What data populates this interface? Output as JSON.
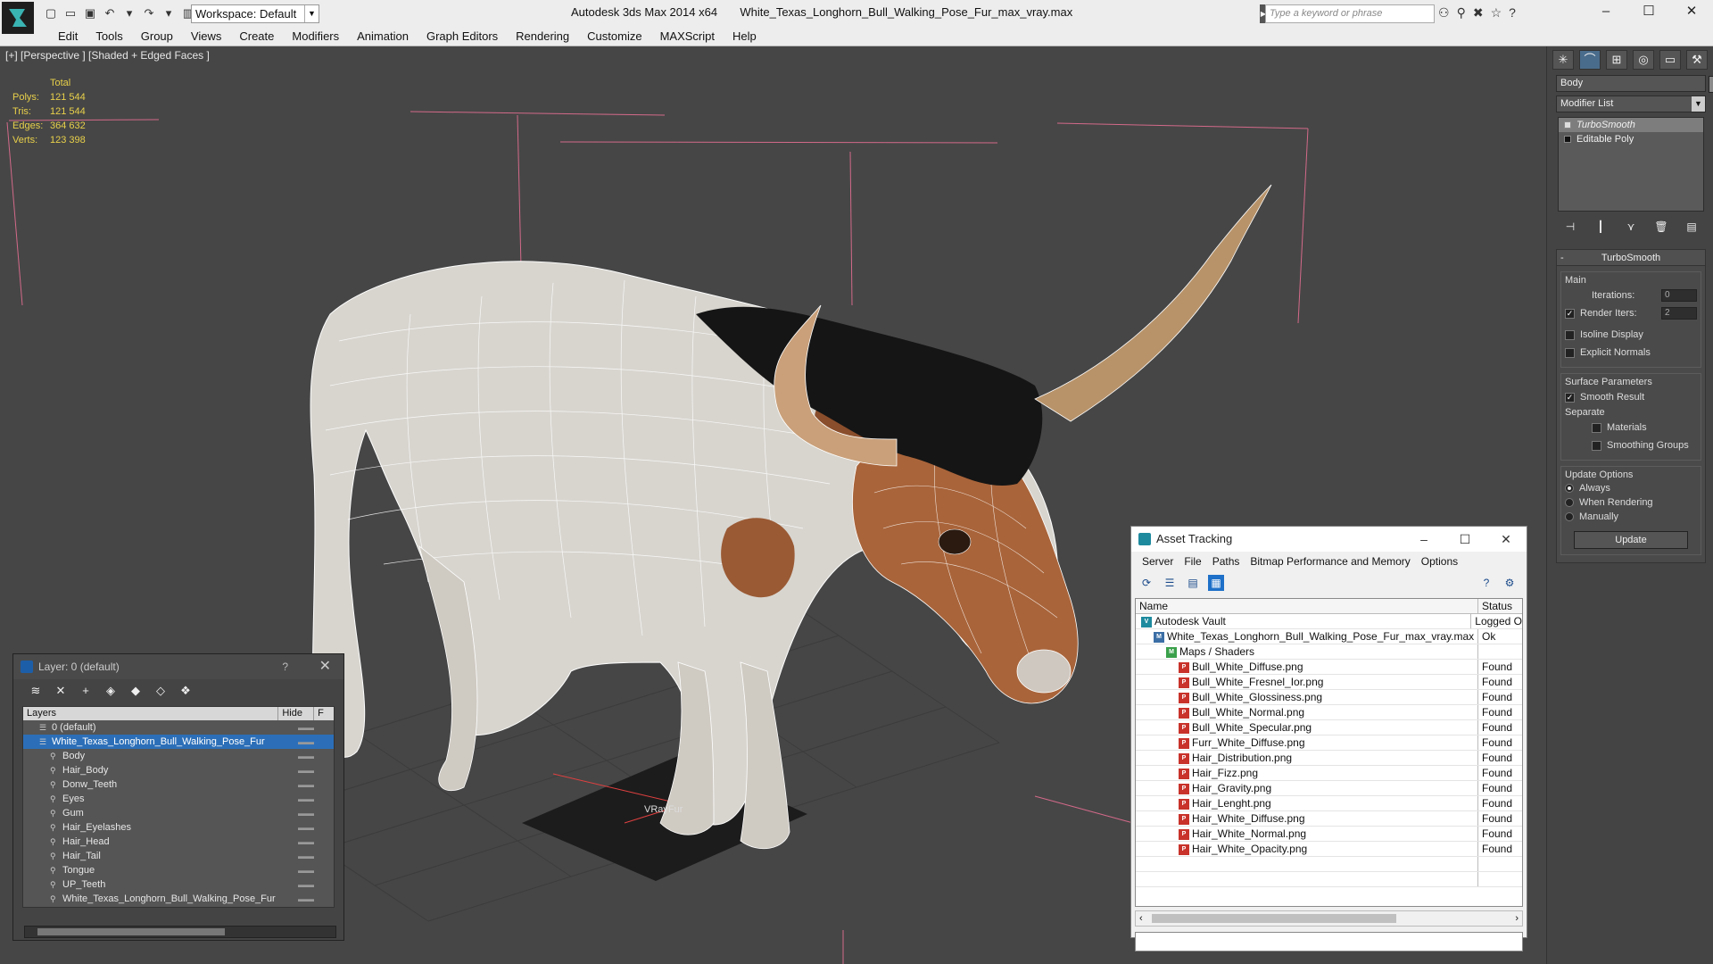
{
  "titlebar": {
    "workspace": "Workspace: Default",
    "app": "Autodesk 3ds Max  2014 x64",
    "file": "White_Texas_Longhorn_Bull_Walking_Pose_Fur_max_vray.max",
    "search_placeholder": "Type a keyword or phrase",
    "controls": [
      "–",
      "☐",
      "✕"
    ]
  },
  "menu": [
    "Edit",
    "Tools",
    "Group",
    "Views",
    "Create",
    "Modifiers",
    "Animation",
    "Graph Editors",
    "Rendering",
    "Customize",
    "MAXScript",
    "Help"
  ],
  "viewport": {
    "label": "[+] [Perspective ] [Shaded + Edged Faces ]",
    "stats_header": "Total",
    "stats": [
      {
        "key": "Polys:",
        "value": "121 544"
      },
      {
        "key": "Tris:",
        "value": "121 544"
      },
      {
        "key": "Edges:",
        "value": "364 632"
      },
      {
        "key": "Verts:",
        "value": "123 398"
      }
    ],
    "gizmo_label": "VRayFur"
  },
  "command_panel": {
    "object_name": "Body",
    "modifier_list": "Modifier List",
    "stack": [
      "TurboSmooth",
      "Editable Poly"
    ],
    "rollout_title": "TurboSmooth",
    "main_group": "Main",
    "iterations_label": "Iterations:",
    "iterations_value": "0",
    "render_iters_label": "Render Iters:",
    "render_iters_value": "2",
    "isoline": "Isoline Display",
    "explicit": "Explicit Normals",
    "surface_group": "Surface Parameters",
    "smooth_result": "Smooth Result",
    "separate": "Separate",
    "materials": "Materials",
    "smoothing_groups": "Smoothing Groups",
    "update_group": "Update Options",
    "always": "Always",
    "when_rendering": "When Rendering",
    "manually": "Manually",
    "update_btn": "Update"
  },
  "layers": {
    "title": "Layer: 0 (default)",
    "help": "?",
    "col_layers": "Layers",
    "col_hide": "Hide",
    "col_f": "F",
    "rows": [
      {
        "label": "0 (default)",
        "indent": 1,
        "selected": false
      },
      {
        "label": "White_Texas_Longhorn_Bull_Walking_Pose_Fur",
        "indent": 1,
        "selected": true
      },
      {
        "label": "Body",
        "indent": 2,
        "selected": false
      },
      {
        "label": "Hair_Body",
        "indent": 2,
        "selected": false
      },
      {
        "label": "Donw_Teeth",
        "indent": 2,
        "selected": false
      },
      {
        "label": "Eyes",
        "indent": 2,
        "selected": false
      },
      {
        "label": "Gum",
        "indent": 2,
        "selected": false
      },
      {
        "label": "Hair_Eyelashes",
        "indent": 2,
        "selected": false
      },
      {
        "label": "Hair_Head",
        "indent": 2,
        "selected": false
      },
      {
        "label": "Hair_Tail",
        "indent": 2,
        "selected": false
      },
      {
        "label": "Tongue",
        "indent": 2,
        "selected": false
      },
      {
        "label": "UP_Teeth",
        "indent": 2,
        "selected": false
      },
      {
        "label": "White_Texas_Longhorn_Bull_Walking_Pose_Fur",
        "indent": 2,
        "selected": false
      }
    ]
  },
  "asset_tracking": {
    "title": "Asset Tracking",
    "menu": [
      "Server",
      "File",
      "Paths",
      "Bitmap Performance and Memory",
      "Options"
    ],
    "col_name": "Name",
    "col_status": "Status",
    "rows": [
      {
        "name": "Autodesk Vault",
        "status": "Logged O",
        "type": "vault",
        "indent": 1
      },
      {
        "name": "White_Texas_Longhorn_Bull_Walking_Pose_Fur_max_vray.max",
        "status": "Ok",
        "type": "max",
        "indent": 2
      },
      {
        "name": "Maps / Shaders",
        "status": "",
        "type": "map",
        "indent": 3
      },
      {
        "name": "Bull_White_Diffuse.png",
        "status": "Found",
        "type": "png",
        "indent": 4
      },
      {
        "name": "Bull_White_Fresnel_Ior.png",
        "status": "Found",
        "type": "png",
        "indent": 4
      },
      {
        "name": "Bull_White_Glossiness.png",
        "status": "Found",
        "type": "png",
        "indent": 4
      },
      {
        "name": "Bull_White_Normal.png",
        "status": "Found",
        "type": "png",
        "indent": 4
      },
      {
        "name": "Bull_White_Specular.png",
        "status": "Found",
        "type": "png",
        "indent": 4
      },
      {
        "name": "Furr_White_Diffuse.png",
        "status": "Found",
        "type": "png",
        "indent": 4
      },
      {
        "name": "Hair_Distribution.png",
        "status": "Found",
        "type": "png",
        "indent": 4
      },
      {
        "name": "Hair_Fizz.png",
        "status": "Found",
        "type": "png",
        "indent": 4
      },
      {
        "name": "Hair_Gravity.png",
        "status": "Found",
        "type": "png",
        "indent": 4
      },
      {
        "name": "Hair_Lenght.png",
        "status": "Found",
        "type": "png",
        "indent": 4
      },
      {
        "name": "Hair_White_Diffuse.png",
        "status": "Found",
        "type": "png",
        "indent": 4
      },
      {
        "name": "Hair_White_Normal.png",
        "status": "Found",
        "type": "png",
        "indent": 4
      },
      {
        "name": "Hair_White_Opacity.png",
        "status": "Found",
        "type": "png",
        "indent": 4
      }
    ]
  }
}
